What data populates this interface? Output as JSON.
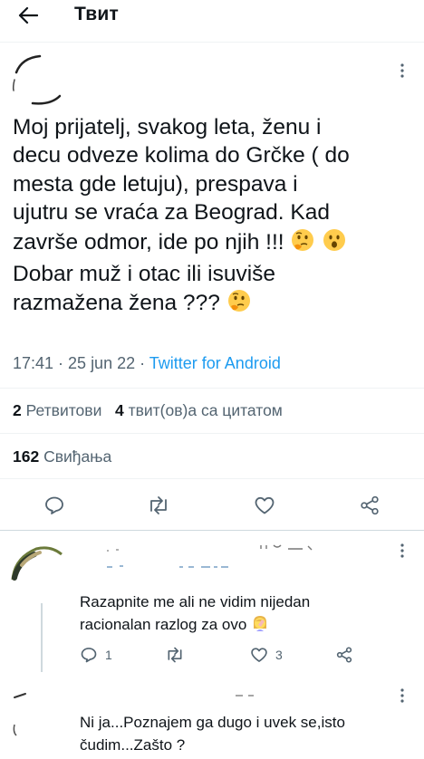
{
  "header": {
    "title": "Твит"
  },
  "tweet": {
    "text": "Moj prijatelj, svakog leta, ženu i\ndecu odveze kolima do Grčke ( do\nmesta gde letuju), prespava i\nujutru se vraća za Beograd. Kad\nzavrše odmor, ide po njih !!! ",
    "text2": "\nDobar muž i otac ili isuviše\nrazmažena žena ??? ",
    "emojis": [
      "thinking-face-emoji",
      "face-with-open-mouth-emoji",
      "thinking-face-emoji"
    ],
    "time": "17:41 · 25 jun 22 · ",
    "source": "Twitter for Android",
    "retweets_count": "2",
    "retweets_label": " Ретвитови",
    "quotes_count": "4",
    "quotes_label": " твит(ов)а са цитатом",
    "likes_count": "162",
    "likes_label": " Свиђања"
  },
  "replies": [
    {
      "text": "Razapnite me ali ne vidim nijedan\nracionalan razlog za ovo ",
      "emoji": "woman-facepalming-emoji",
      "reply_count": "1",
      "retweet_count": "",
      "like_count": "3"
    },
    {
      "text": "Ni ja...Poznajem ga dugo i uvek se,isto\nčudim...Zašto ?"
    }
  ],
  "colors": {
    "accent": "#1d9bf0",
    "secondary": "#536471",
    "text": "#0f1419",
    "divider": "#eff3f4"
  }
}
